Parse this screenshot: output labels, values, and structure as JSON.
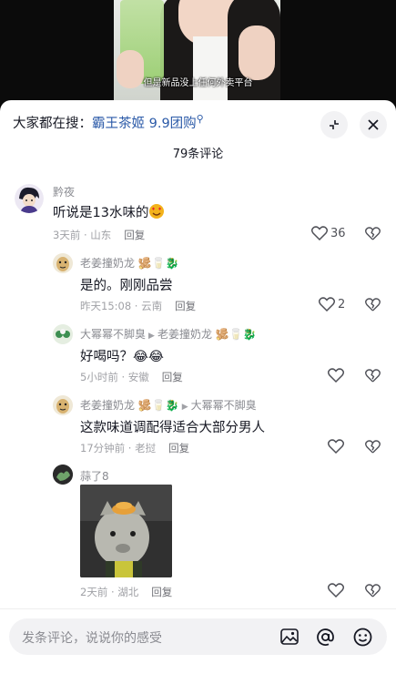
{
  "video": {
    "subtitle": "但是新品没上任何外卖平台"
  },
  "header": {
    "search_prefix": "大家都在搜：",
    "search_term": "霸王茶姬 9.9团购",
    "comment_count": "79条评论"
  },
  "comments": [
    {
      "user": "黔夜",
      "text": "听说是13水味的",
      "time_loc": "3天前 · 山东",
      "reply_label": "回复",
      "likes": "36"
    },
    {
      "user": "老姜撞奶龙",
      "text": "是的。刚刚品尝",
      "time_loc": "昨天15:08 · 云南",
      "reply_label": "回复",
      "likes": "2"
    },
    {
      "user": "大幂幂不脚臭",
      "reply_to": "老姜撞奶龙",
      "text": "好喝吗？",
      "time_loc": "5小时前 · 安徽",
      "reply_label": "回复",
      "likes": ""
    },
    {
      "user": "老姜撞奶龙",
      "reply_to": "大幂幂不脚臭",
      "text": "这款味道调配得适合大部分男人",
      "time_loc": "17分钟前 · 老挝",
      "reply_label": "回复",
      "likes": ""
    },
    {
      "user": "蒜了8",
      "text": "",
      "time_loc": "2天前 · 湖北",
      "reply_label": "回复",
      "likes": ""
    }
  ],
  "input": {
    "placeholder": "发条评论，说说你的感受"
  }
}
